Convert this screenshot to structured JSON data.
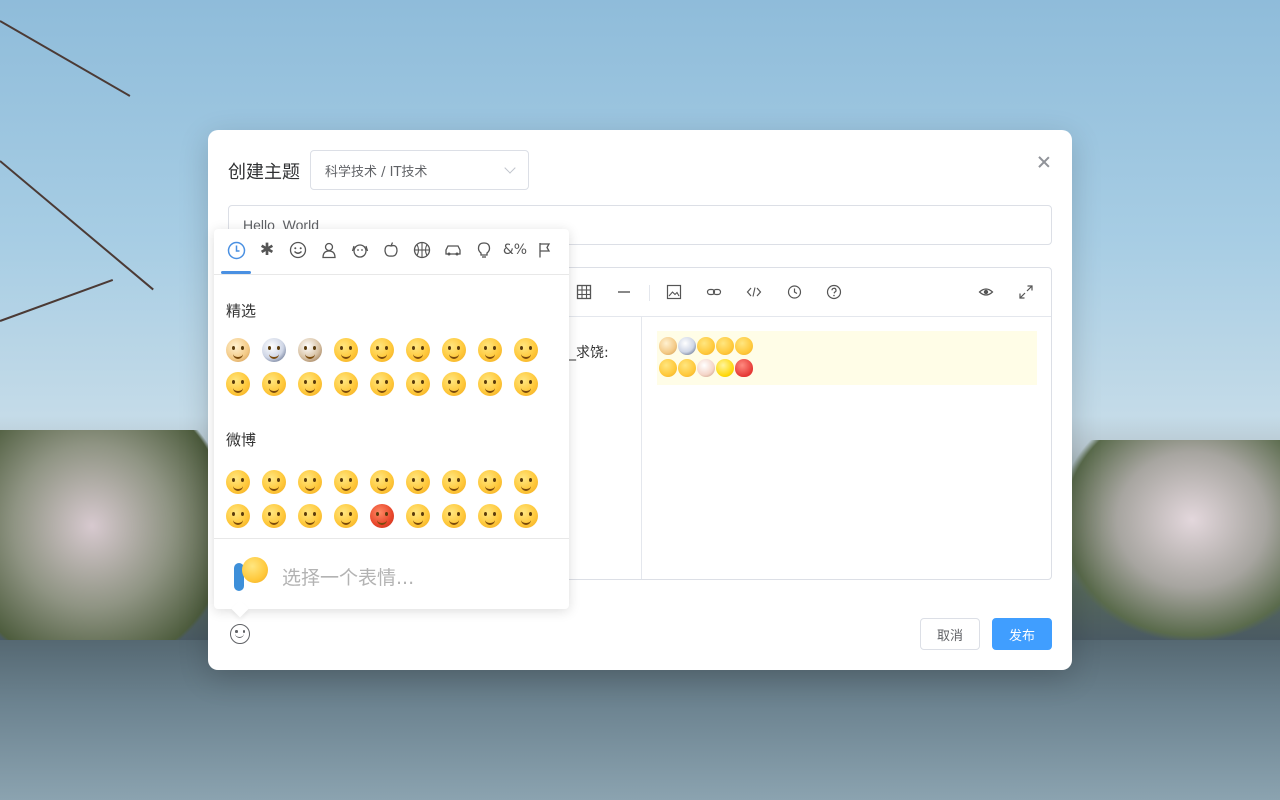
{
  "modal": {
    "title": "创建主题",
    "category_value": "科学技术 / IT技术",
    "title_input_value": "Hello  World",
    "cancel_label": "取消",
    "publish_label": "发布"
  },
  "editor": {
    "toolbar_icons": [
      "table-icon",
      "horizontal-rule-icon",
      "image-icon",
      "link-icon",
      "code-icon",
      "history-icon",
      "help-icon",
      "preview-toggle-icon",
      "fullscreen-icon"
    ],
    "edit_text_visible": "_求饶:",
    "preview_line1_icons": [
      "dog-emoji",
      "panda-emoji",
      "laughing-emoji",
      "rolling-laugh-emoji",
      "shy-emoji"
    ],
    "preview_line2_icons": [
      "wink-emoji",
      "pointing-hand-emoji",
      "cow-emoji",
      "lemon-emoji",
      "balloon-emoji"
    ]
  },
  "emoji_picker": {
    "categories": [
      "recent-clock-icon",
      "asterisk-icon",
      "smiley-icon",
      "person-icon",
      "dog-icon",
      "apple-icon",
      "basketball-icon",
      "car-icon",
      "lightbulb-icon",
      "symbols-icon",
      "flags-icon"
    ],
    "active_category": "recent-clock-icon",
    "sections": [
      {
        "title": "精选",
        "count": 18
      },
      {
        "title": "微博",
        "count": 18
      }
    ],
    "footer_placeholder": "选择一个表情..."
  },
  "colors": {
    "primary": "#409eff",
    "picker_accent": "#4a90e2",
    "preview_highlight": "#fffde7"
  }
}
